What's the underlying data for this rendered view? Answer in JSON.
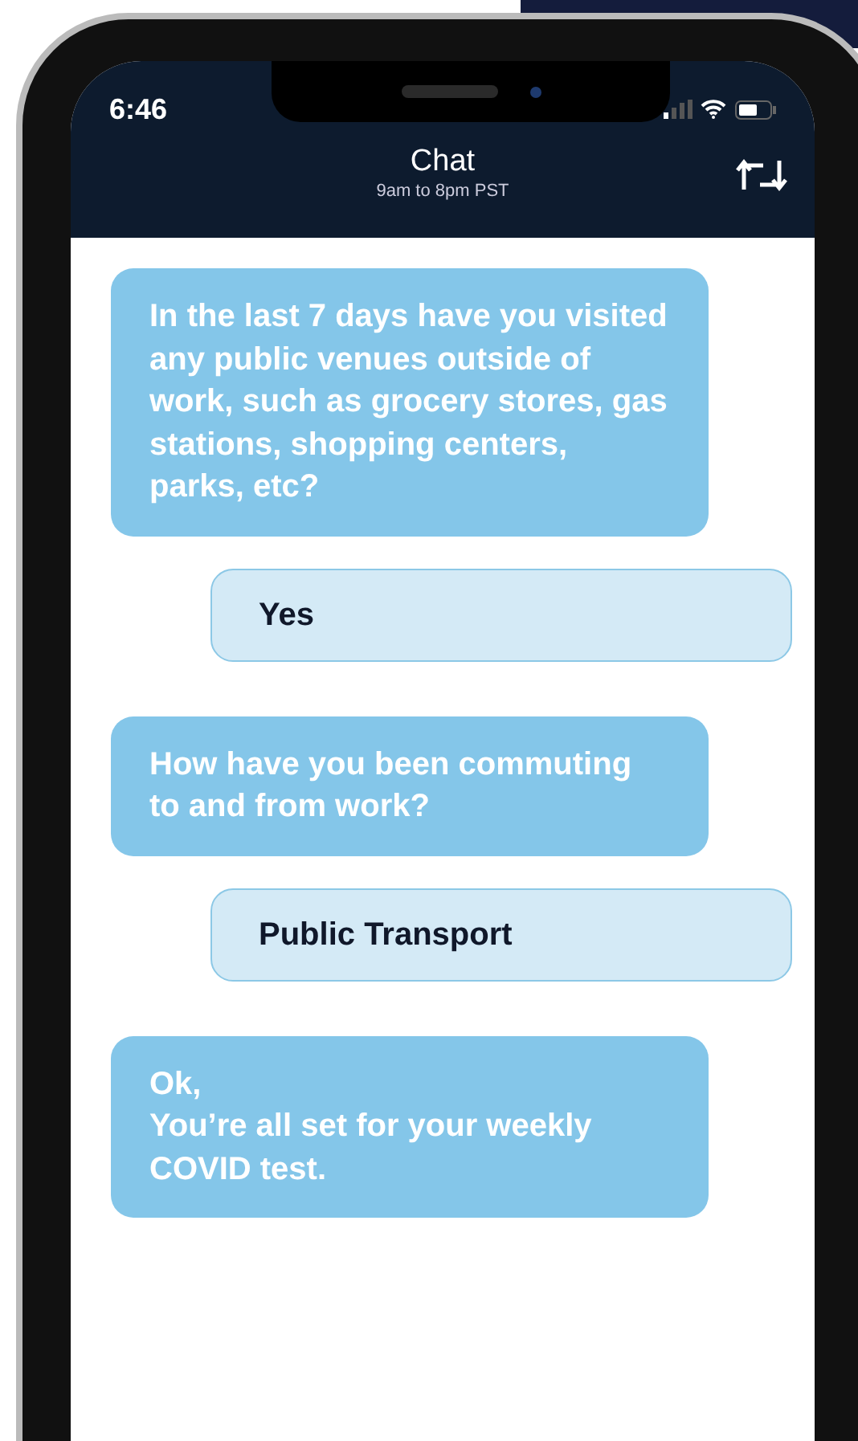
{
  "status_bar": {
    "time": "6:46"
  },
  "header": {
    "title": "Chat",
    "subtitle": "9am to 8pm PST"
  },
  "messages": [
    {
      "kind": "bot",
      "text": "In the last 7 days have you visited any public venues outside of work, such as grocery stores, gas stations, shopping centers, parks, etc?"
    },
    {
      "kind": "user",
      "text": "Yes"
    },
    {
      "kind": "bot",
      "text": "How have you been commuting to and from work?"
    },
    {
      "kind": "user",
      "text": "Public Transport"
    },
    {
      "kind": "bot",
      "text": "Ok,\nYou’re all set for your weekly COVID test."
    }
  ]
}
